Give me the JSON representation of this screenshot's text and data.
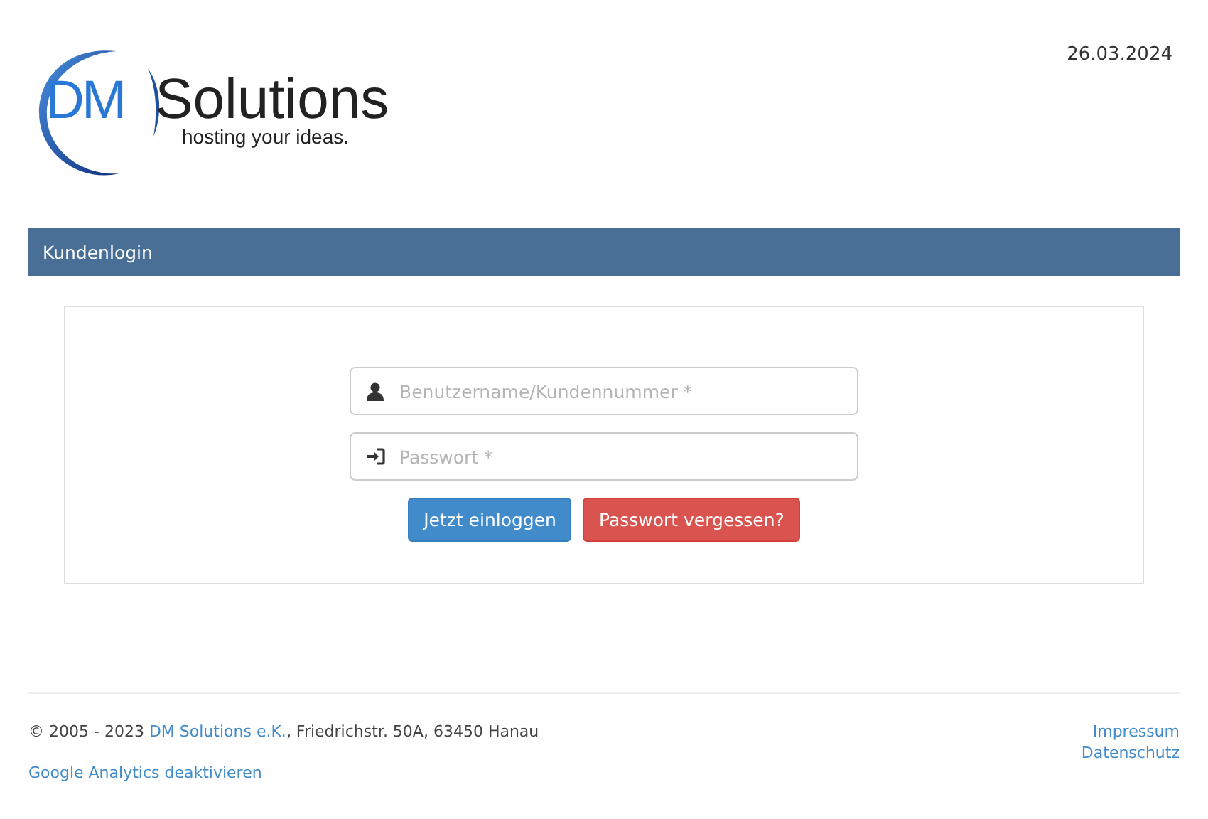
{
  "date": "26.03.2024",
  "logo": {
    "initials": "DM",
    "name": "Solutions",
    "tagline": "hosting your ideas."
  },
  "header": {
    "title": "Kundenlogin"
  },
  "form": {
    "fields": [
      {
        "kind": "user",
        "placeholder": "Benutzername/Kundennummer *"
      },
      {
        "kind": "password",
        "placeholder": "Passwort *"
      }
    ],
    "buttons": [
      {
        "kind": "primary",
        "label": "Jetzt einloggen"
      },
      {
        "kind": "danger",
        "label": "Passwort vergessen?"
      }
    ]
  },
  "footer": {
    "copyright_before": "© 2005 - 2023 ",
    "company_link": "DM Solutions e.K.",
    "copyright_after": ", Friedrichstr. 50A, 63450 Hanau",
    "analytics_link": "Google Analytics deaktivieren",
    "links": [
      "Impressum",
      "Datenschutz"
    ]
  }
}
